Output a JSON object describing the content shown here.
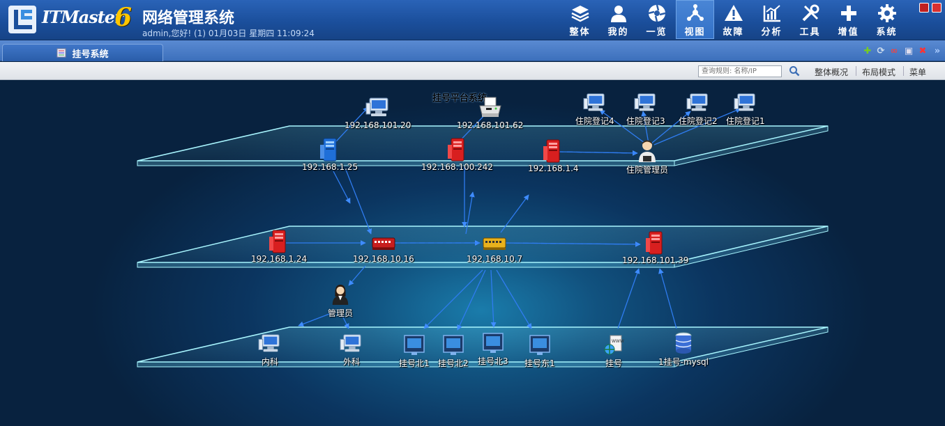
{
  "app": {
    "brand": "ITMaster",
    "brand_version": "6",
    "system_title": "网络管理系统",
    "user_info": "admin,您好! (1) 01月03日 星期四 11:09:24"
  },
  "nav": [
    {
      "label": "整体",
      "icon": "layers-icon"
    },
    {
      "label": "我的",
      "icon": "user-icon"
    },
    {
      "label": "一览",
      "icon": "aperture-icon"
    },
    {
      "label": "视图",
      "icon": "topology-icon",
      "active": true
    },
    {
      "label": "故障",
      "icon": "warning-icon"
    },
    {
      "label": "分析",
      "icon": "chart-icon"
    },
    {
      "label": "工具",
      "icon": "tools-icon"
    },
    {
      "label": "增值",
      "icon": "plus-icon"
    },
    {
      "label": "系统",
      "icon": "gear-icon"
    }
  ],
  "tab": {
    "label": "挂号系统"
  },
  "toolbar": {
    "search_placeholder": "查询规则: 名称/IP",
    "links": [
      "整体概况",
      "布局模式",
      "菜单"
    ]
  },
  "topology": {
    "title": "挂号平台系统",
    "nodes": {
      "pc_101_20": "192.168.101.20",
      "printer_101_62": "192.168.101.62",
      "zydj4": "住院登记4",
      "zydj3": "住院登记3",
      "zydj2": "住院登记2",
      "zydj1": "住院登记1",
      "srv_1_25": "192.168.1.25",
      "srv_100_242": "192.168.100.242",
      "srv_1_4": "192.168.1.4",
      "zy_admin": "住院管理员",
      "srv_1_24": "192.168.1.24",
      "sw_10_16": "192.168.10.16",
      "sw_10_7": "192.168.10.7",
      "srv_101_39": "192.168.101.39",
      "admin": "管理员",
      "neike": "内科",
      "waike": "外科",
      "ghb1": "挂号北1",
      "ghb2": "挂号北2",
      "ghb3": "挂号北3",
      "ghd1": "挂号东1",
      "gh": "挂号",
      "gh_mysql": "1挂号-mysql"
    }
  }
}
